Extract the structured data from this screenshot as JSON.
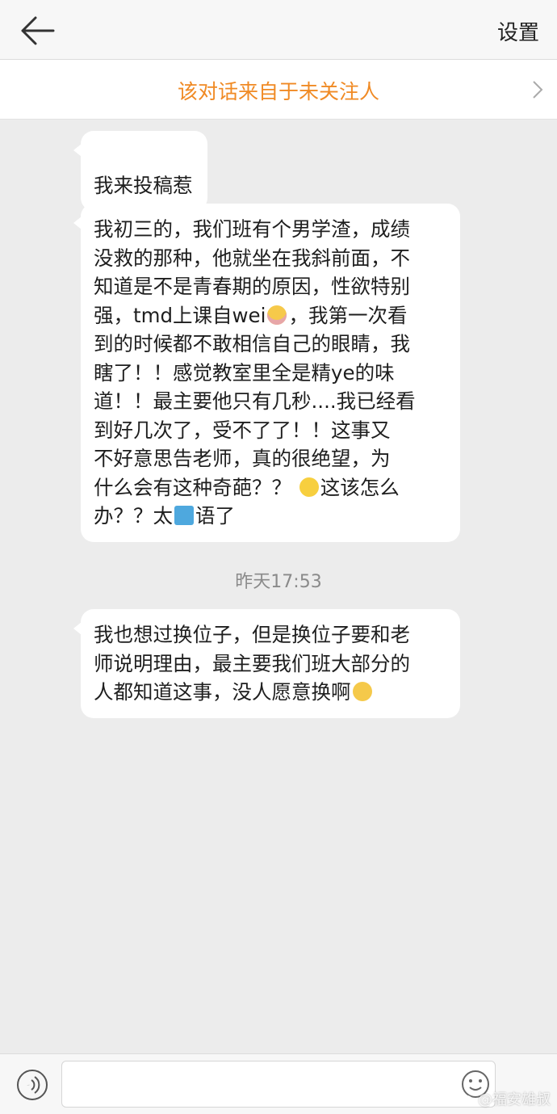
{
  "header": {
    "settings_label": "设置"
  },
  "notice": {
    "text": "该对话来自于未关注人"
  },
  "messages": [
    {
      "text": "我来投稿惹"
    },
    {
      "l1": "我初三的，我们班有个男学渣，成绩",
      "l2": "没救的那种，他就坐在我斜前面，不",
      "l3": "知道是不是青春期的原因，性欲特别",
      "l4a": "强，tmd上课自wei",
      "l4b": "，我第一次看",
      "l5": "到的时候都不敢相信自己的眼睛，我",
      "l6": "瞎了！！感觉教室里全是精ye的味",
      "l7": "道！！最主要他只有几秒....我已经看",
      "l8": "到好几次了，受不了了！！这事又",
      "l9": "不好意思告老师，真的很绝望，为",
      "l10a": "什么会有这种奇葩？？",
      "l10b": "这该怎么",
      "l11a": "办？？太",
      "l11b": "语了"
    },
    {
      "l1": "我也想过换位子，但是换位子要和老",
      "l2": "师说明理由，最主要我们班大部分的",
      "l3a": "人都知道这事，没人愿意换啊"
    }
  ],
  "timestamp": "昨天17:53",
  "emoji_icons": [
    "crying-emoji",
    "smile-emoji",
    "wu-character-emoji",
    "pleading-emoji"
  ],
  "watermark": "@福安雄叔",
  "colors": {
    "accent": "#f08a24",
    "background": "#ececec",
    "bubble": "#ffffff"
  }
}
